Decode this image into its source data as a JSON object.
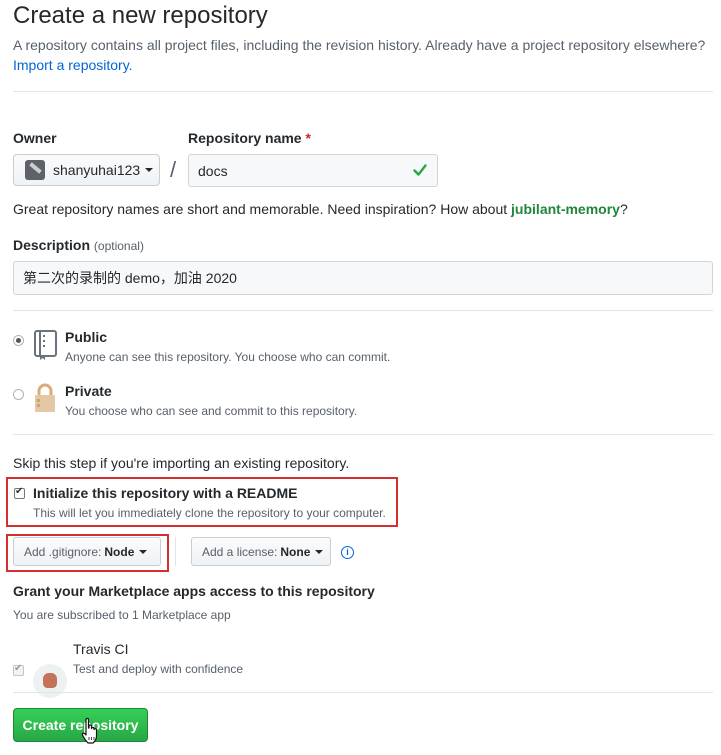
{
  "header": {
    "title": "Create a new repository",
    "subtitle": "A repository contains all project files, including the revision history. Already have a project repository elsewhere?",
    "import_link": "Import a repository."
  },
  "owner": {
    "label": "Owner",
    "value": "shanyuhai123"
  },
  "repo_name": {
    "label": "Repository name",
    "required_mark": "*",
    "value": "docs",
    "separator": "/"
  },
  "name_help": {
    "text": "Great repository names are short and memorable. Need inspiration? How about",
    "suggestion": "jubilant-memory",
    "end": "?"
  },
  "description": {
    "label": "Description",
    "optional": "(optional)",
    "value": "第二次的录制的 demo，加油 2020"
  },
  "visibility": {
    "public": {
      "title": "Public",
      "desc": "Anyone can see this repository. You choose who can commit.",
      "selected": true
    },
    "private": {
      "title": "Private",
      "desc": "You choose who can see and commit to this repository.",
      "selected": false
    }
  },
  "init": {
    "skip_text": "Skip this step if you're importing an existing repository.",
    "readme_label": "Initialize this repository with a README",
    "readme_desc": "This will let you immediately clone the repository to your computer.",
    "readme_checked": true
  },
  "gitignore": {
    "prefix": "Add .gitignore:",
    "value": "Node"
  },
  "license": {
    "prefix": "Add a license:",
    "value": "None"
  },
  "marketplace": {
    "heading": "Grant your Marketplace apps access to this repository",
    "sub": "You are subscribed to 1 Marketplace app",
    "app_name": "Travis CI",
    "app_desc": "Test and deploy with confidence",
    "app_checked": true
  },
  "submit": {
    "label": "Create repository"
  },
  "colors": {
    "accent_link": "#0366d6",
    "success_green": "#28a745",
    "highlight_red": "#d32f2f"
  }
}
